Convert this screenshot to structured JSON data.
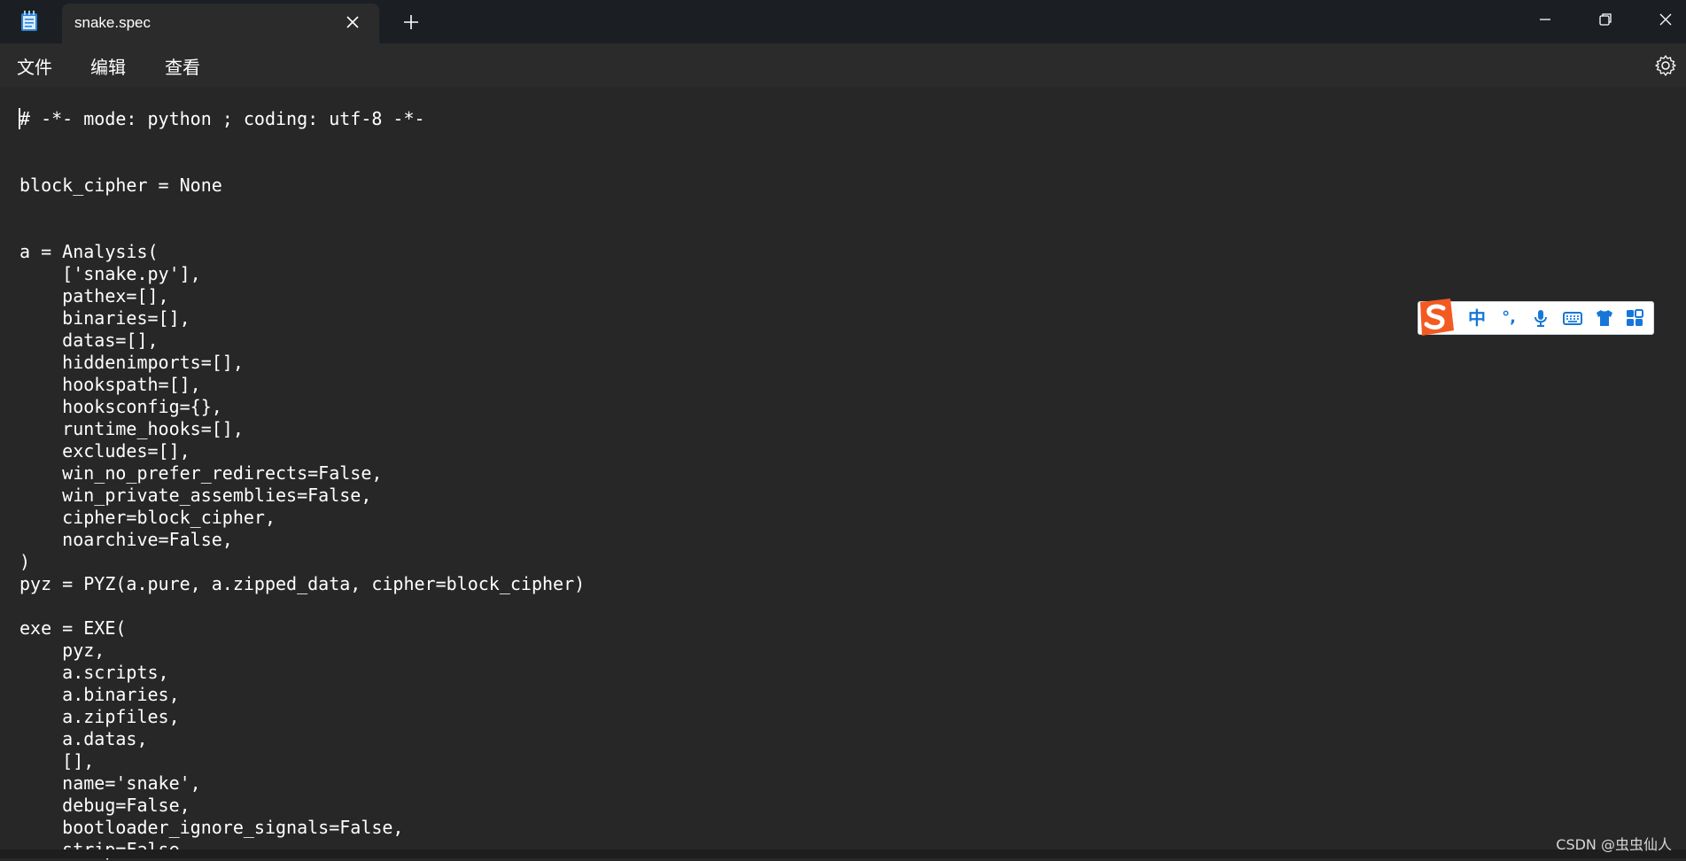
{
  "app": {
    "tab_title": "snake.spec"
  },
  "menu": {
    "file": "文件",
    "edit": "编辑",
    "view": "查看"
  },
  "editor": {
    "lines": [
      "# -*- mode: python ; coding: utf-8 -*-",
      "",
      "",
      "block_cipher = None",
      "",
      "",
      "a = Analysis(",
      "    ['snake.py'],",
      "    pathex=[],",
      "    binaries=[],",
      "    datas=[],",
      "    hiddenimports=[],",
      "    hookspath=[],",
      "    hooksconfig={},",
      "    runtime_hooks=[],",
      "    excludes=[],",
      "    win_no_prefer_redirects=False,",
      "    win_private_assemblies=False,",
      "    cipher=block_cipher,",
      "    noarchive=False,",
      ")",
      "pyz = PYZ(a.pure, a.zipped_data, cipher=block_cipher)",
      "",
      "exe = EXE(",
      "    pyz,",
      "    a.scripts,",
      "    a.binaries,",
      "    a.zipfiles,",
      "    a.datas,",
      "    [],",
      "    name='snake',",
      "    debug=False,",
      "    bootloader_ignore_signals=False,",
      "    strip=False,"
    ]
  },
  "ime": {
    "mode_label": "中",
    "punct_label": "°,"
  },
  "watermark": "CSDN @虫虫仙人",
  "colors": {
    "titlebar": "#1b1f24",
    "menubar": "#2b2b2b",
    "editor_bg": "#272727",
    "text": "#ffffff",
    "ime_accent": "#1677d8",
    "ime_logo": "#f25a22"
  },
  "icons": {
    "app": "notepad-icon",
    "tab_close": "close-icon",
    "new_tab": "plus-icon",
    "minimize": "minimize-icon",
    "maximize": "restore-icon",
    "close": "close-icon",
    "settings": "gear-icon",
    "ime_logo": "sogou-s-icon",
    "ime_mic": "microphone-icon",
    "ime_keyboard": "keyboard-icon",
    "ime_skin": "shirt-icon",
    "ime_tools": "grid-icon"
  }
}
